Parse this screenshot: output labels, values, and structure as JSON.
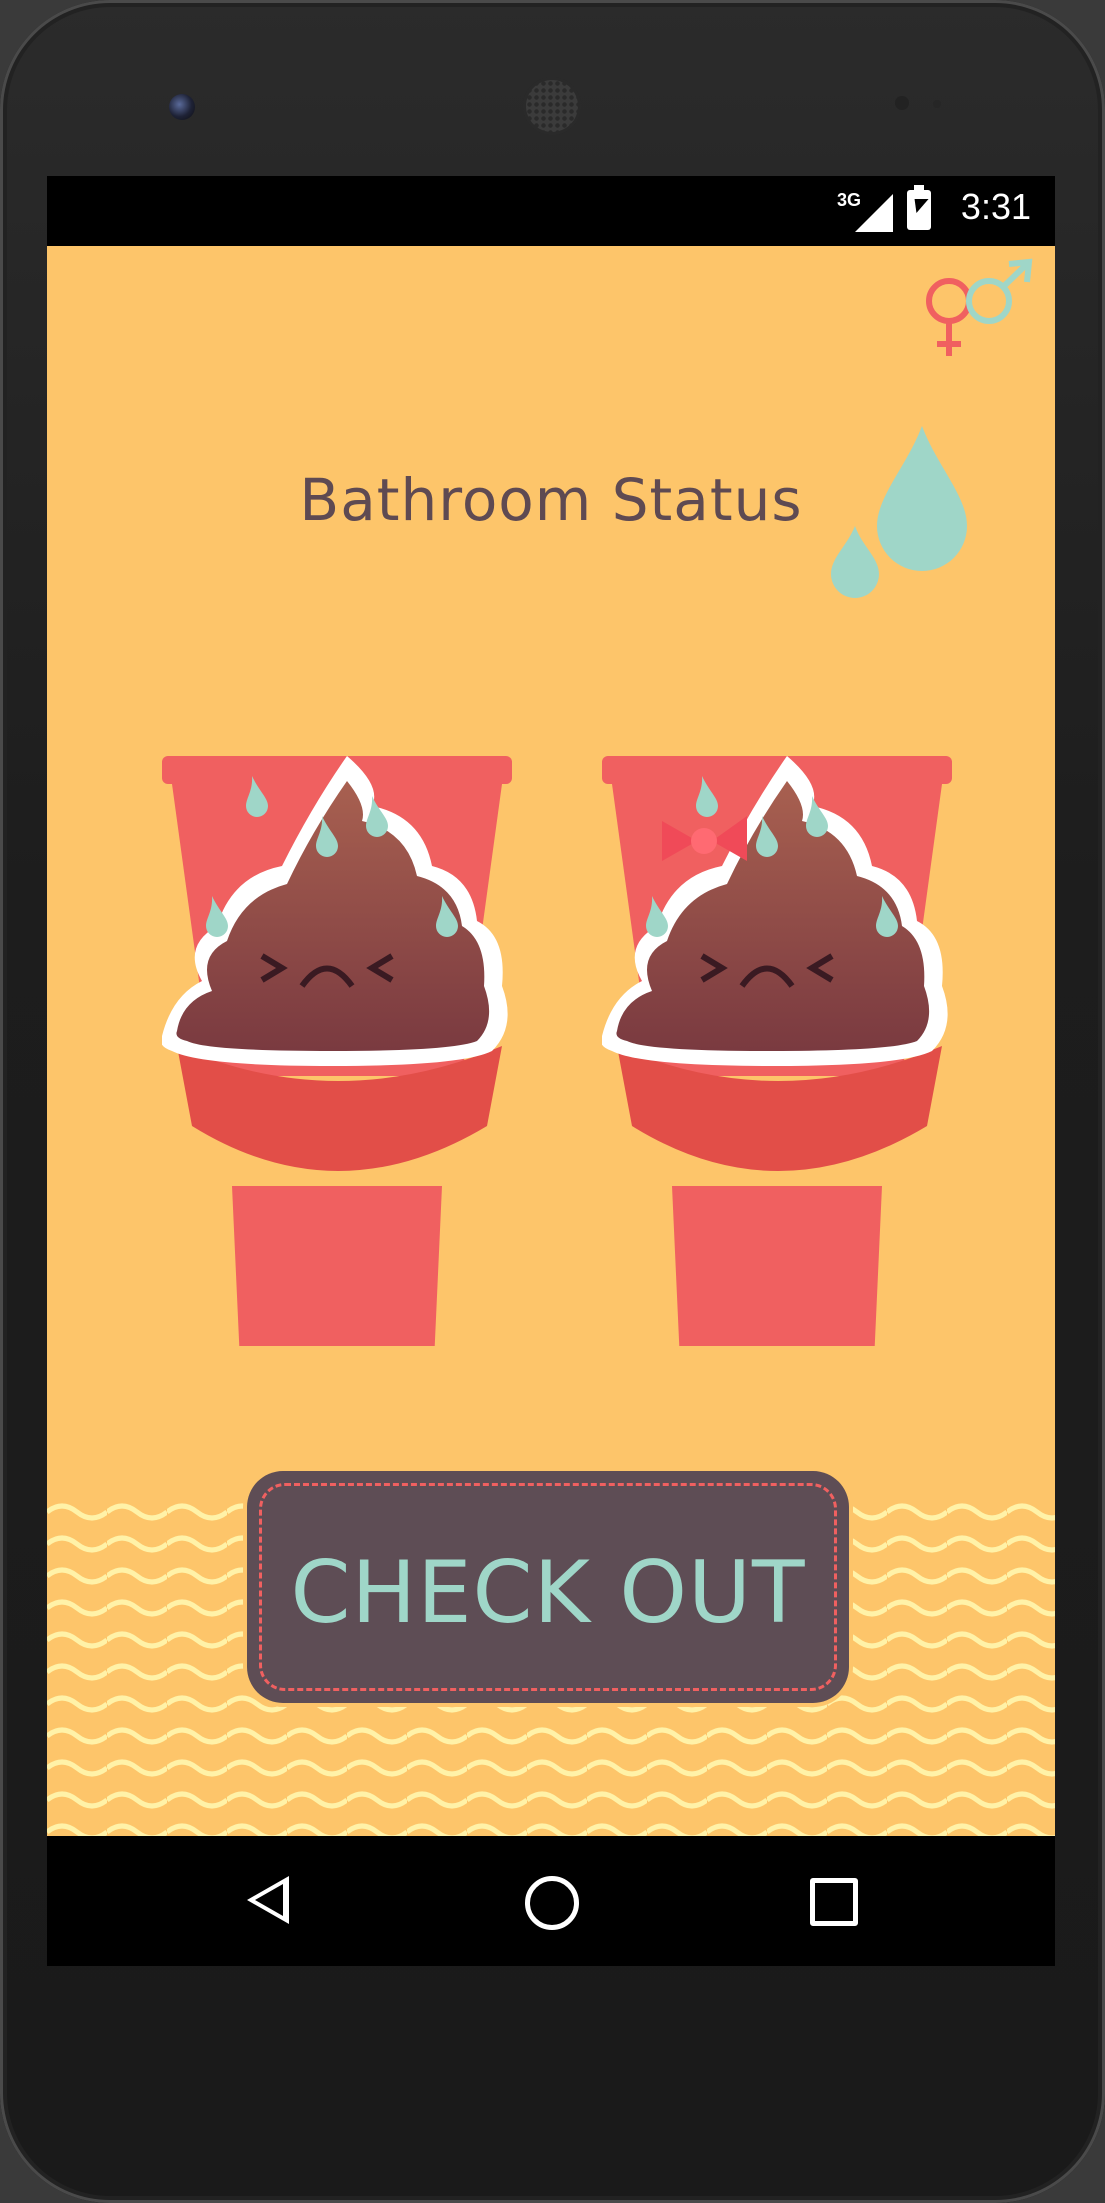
{
  "status_bar": {
    "network": "3G",
    "time": "3:31"
  },
  "app": {
    "title": "Bathroom Status",
    "checkout_label": "CHECK OUT",
    "colors": {
      "background": "#fdc56a",
      "title": "#5e4a52",
      "toilet": "#f06060",
      "poop": "#8a4a4a",
      "drop": "#9fd6c8",
      "button": "#5e4d55",
      "wave": "#fff2a8",
      "female": "#f06060",
      "male": "#9fd6c8"
    },
    "icons": {
      "gender": "gender-icon",
      "drops": "water-drops-icon"
    },
    "stalls": [
      {
        "label": "stall-left",
        "occupant": "poop-face"
      },
      {
        "label": "stall-right",
        "occupant": "poop-face-with-bow"
      }
    ]
  },
  "nav": {
    "back": "back-icon",
    "home": "home-icon",
    "recents": "recents-icon"
  }
}
